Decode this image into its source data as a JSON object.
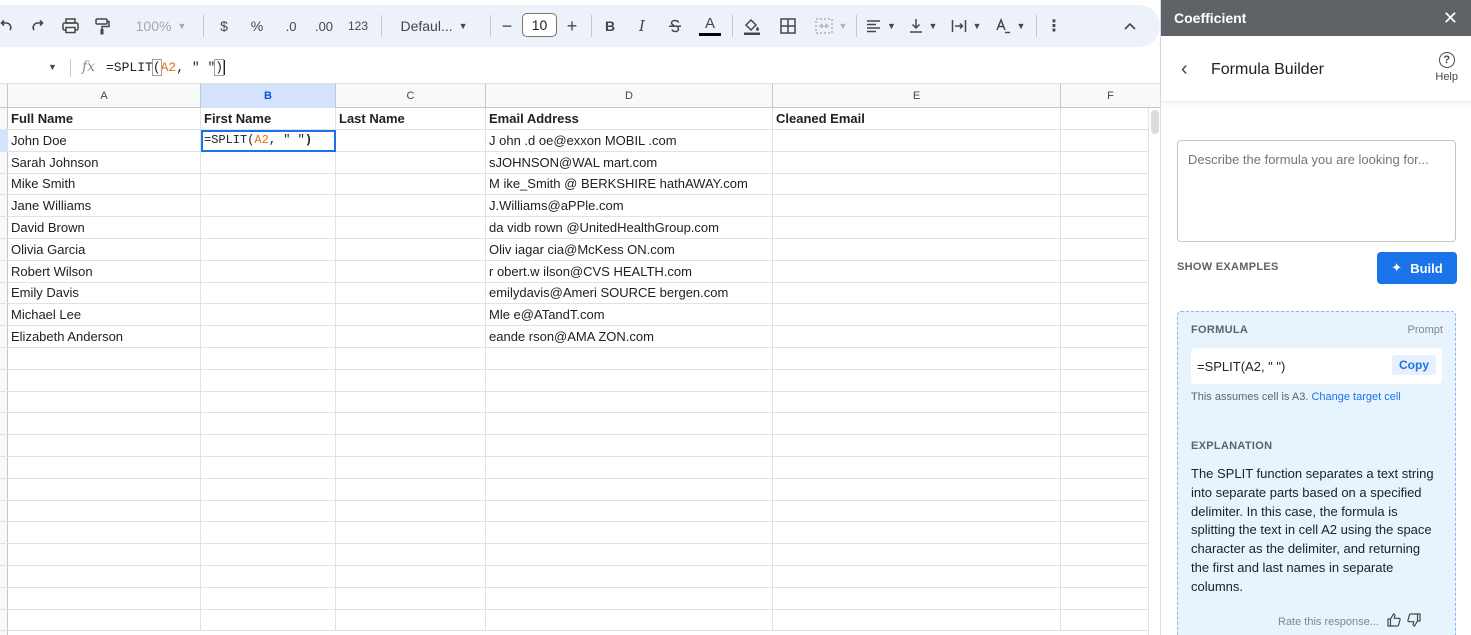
{
  "toolbar": {
    "zoom": "100%",
    "currency": "$",
    "percent": "%",
    "dec_decrease": ".0",
    "dec_increase": ".00",
    "number_format": "123",
    "font": "Defaul...",
    "font_size": "10",
    "minus": "−",
    "plus": "+",
    "bold": "B",
    "italic": "I",
    "text_color": "A"
  },
  "formula_bar": {
    "fx": "fx",
    "formula_prefix": "=SPLIT",
    "formula_open": "(",
    "formula_ref": "A2",
    "formula_rest": ", \" \"",
    "formula_close": ")"
  },
  "columns": [
    "A",
    "B",
    "C",
    "D",
    "E",
    "F"
  ],
  "sheet": {
    "headers": [
      "Full Name",
      "First Name",
      "Last Name",
      "Email Address",
      "Cleaned Email"
    ],
    "rows": [
      {
        "full_name": "John Doe",
        "email": "J ohn .d oe@exxon  MOBIL  .com"
      },
      {
        "full_name": "Sarah Johnson",
        "email": "sJOHNSON@WAL  mart.com"
      },
      {
        "full_name": "Mike Smith",
        "email": "M ike_Smith @ BERKSHIRE  hathAWAY.com"
      },
      {
        "full_name": "Jane Williams",
        "email": "J.Williams@aPPle.com"
      },
      {
        "full_name": "David Brown",
        "email": "da vidb rown @UnitedHealthGroup.com"
      },
      {
        "full_name": "Olivia Garcia",
        "email": "Oliv iagar cia@McKess ON.com"
      },
      {
        "full_name": "Robert Wilson",
        "email": "r obert.w ilson@CVS  HEALTH.com"
      },
      {
        "full_name": "Emily Davis",
        "email": "emilydavis@Ameri  SOURCE bergen.com"
      },
      {
        "full_name": "Michael Lee",
        "email": "Mle e@ATandT.com"
      },
      {
        "full_name": "Elizabeth Anderson",
        "email": "eande rson@AMA ZON.com"
      }
    ],
    "active_cell": {
      "prefix": "=SPLIT(",
      "ref": "A2",
      "rest": ", \" \"",
      "close": ")"
    }
  },
  "panel": {
    "app_name": "Coefficient",
    "title": "Formula Builder",
    "help": "Help",
    "prompt_placeholder": "Describe the formula you are looking for...",
    "show_examples": "SHOW EXAMPLES",
    "build": "Build",
    "formula_label": "FORMULA",
    "prompt_link": "Prompt",
    "formula": "=SPLIT(A2, \" \")",
    "copy": "Copy",
    "assume_text": "This assumes cell is A3.",
    "change_target": "Change target cell",
    "explanation_label": "EXPLANATION",
    "explanation": "The SPLIT function separates a text string into separate parts based on a specified delimiter. In this case, the formula is splitting the text in cell A2 using the space character as the delimiter, and returning the first and last names in separate columns.",
    "rate": "Rate this response..."
  }
}
